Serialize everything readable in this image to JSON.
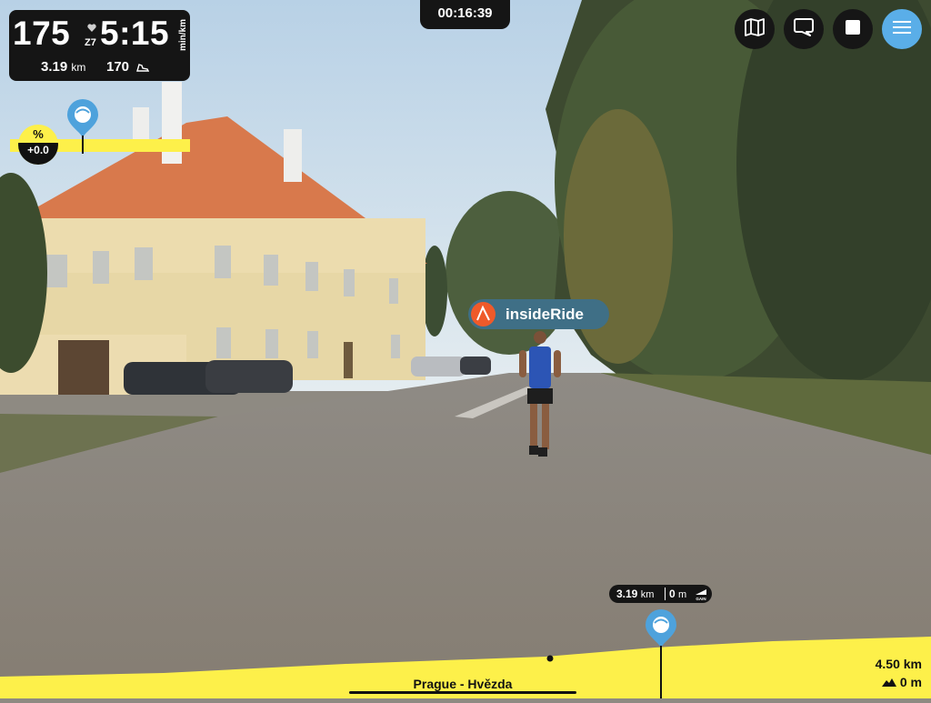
{
  "metrics": {
    "heart_rate": "175",
    "heart_zone": "Z7",
    "pace": "5:15",
    "pace_unit": "min/km",
    "distance": "3.19",
    "distance_unit": "km",
    "cadence": "170"
  },
  "timer": "00:16:39",
  "toolbar": {
    "map_icon": "map-icon",
    "chat_icon": "chat-icon",
    "stop_icon": "stop-icon",
    "menu_icon": "menu-icon",
    "menu_color": "#5aaee8"
  },
  "grade": {
    "symbol": "%",
    "value": "+0.0",
    "bar_color": "#fdf04a"
  },
  "overlay": {
    "brand_label": "insideRide"
  },
  "elevation": {
    "position_distance": "3.19",
    "position_distance_unit": "km",
    "position_gain": "0",
    "position_gain_unit": "m",
    "gain_caption": "GAIN",
    "route_name": "Prague - Hvězda",
    "total_distance": "4.50 km",
    "total_gain": "0 m",
    "profile_color": "#fdf04a"
  }
}
